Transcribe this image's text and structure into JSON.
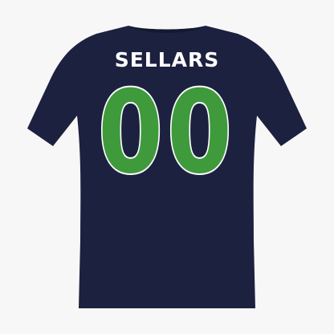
{
  "jersey": {
    "name": "SELLARS",
    "number": "00"
  },
  "colors": {
    "background": "#f7f7f7",
    "shirt": "#1d2140",
    "number_fill": "#3f9a3c",
    "number_outline": "#ffffff",
    "name_text": "#ffffff"
  }
}
